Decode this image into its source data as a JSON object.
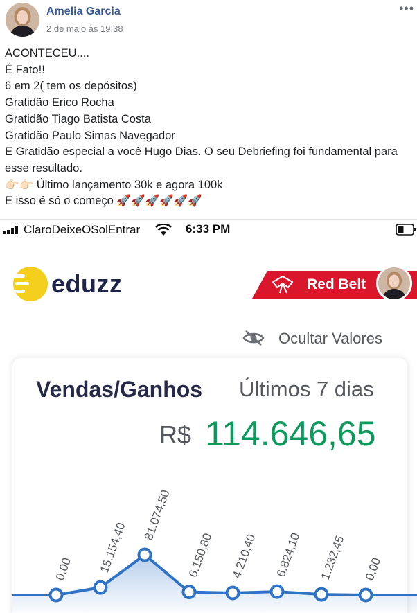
{
  "post": {
    "author": "Amelia Garcia",
    "date": "2 de maio às 19:38",
    "more": "•••",
    "lines": [
      "ACONTECEU....",
      "É Fato!!",
      "6 em 2( tem os depósitos)",
      "Gratidão Erico Rocha",
      "Gratidão Tiago Batista Costa",
      "Gratidão Paulo Simas Navegador",
      "E Gratidão especial a você Hugo Dias. O seu Debriefing foi fundamental para esse resultado."
    ],
    "line8_emoji": "👉🏻👉🏻",
    "line8_text": "Último lançamento 30k e agora 100k",
    "line9_text": "E isso é só o começo",
    "line9_emoji": "🚀🚀🚀🚀🚀🚀"
  },
  "status_bar": {
    "carrier": "ClaroDeixeOSolEntrar",
    "time": "6:33 PM"
  },
  "app": {
    "logo_text": "eduzz",
    "belt_label": "Red Belt",
    "hide_values_label": "Ocultar Valores",
    "card_title": "Vendas/Ganhos",
    "card_period": "Últimos 7 dias",
    "currency": "R$",
    "total": "114.646,65",
    "colors": {
      "brand_yellow": "#f5cf1e",
      "belt_red": "#d9162b",
      "total_green": "#0d9a5c",
      "line_blue": "#2f73c6"
    }
  },
  "chart_data": {
    "type": "line",
    "labels": [
      "0,00",
      "15.154,40",
      "81.074,50",
      "6.150,80",
      "4.210,40",
      "6.824,10",
      "1.232,45",
      "0,00"
    ],
    "values": [
      0,
      15154.4,
      81074.5,
      6150.8,
      4210.4,
      6824.1,
      1232.45,
      0
    ]
  }
}
